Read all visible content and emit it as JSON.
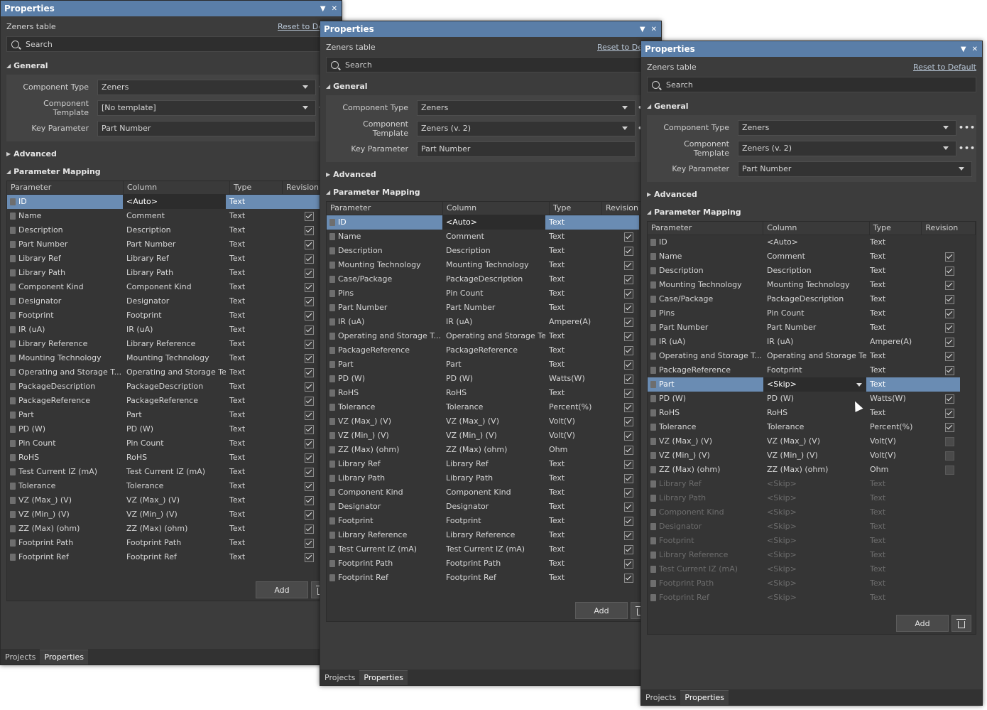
{
  "panel_title": "Properties",
  "panel_subtitle": "Zeners table",
  "reset_label": "Reset to Default",
  "reset_label_clipped": "Reset to De",
  "reset_label_clipped2": "Reset to Def",
  "search_placeholder": "Search",
  "sections": {
    "general": "General",
    "advanced": "Advanced",
    "mapping": "Parameter Mapping"
  },
  "field_labels": {
    "component_type": "Component Type",
    "component_template": "Component Template",
    "key_parameter": "Key Parameter"
  },
  "columns": {
    "parameter": "Parameter",
    "column": "Column",
    "type": "Type",
    "revision": "Revision"
  },
  "buttons": {
    "add": "Add"
  },
  "tabs": {
    "projects": "Projects",
    "properties": "Properties"
  },
  "icons": {
    "search": "search-icon",
    "pin": "pin-icon",
    "close": "close-icon",
    "doc": "document-icon",
    "trash": "trash-icon"
  },
  "colors": {
    "titlebar": "#5a7ea8",
    "selection": "#6a8cb3",
    "panel_bg": "#3c3c3c"
  },
  "panels": [
    {
      "component_type": "Zeners",
      "component_template": "[No template]",
      "key_parameter": "Part Number",
      "rows": [
        {
          "p": "ID",
          "c": "<Auto>",
          "t": "Text",
          "r": "none",
          "sel": true
        },
        {
          "p": "Name",
          "c": "Comment",
          "t": "Text",
          "r": "on"
        },
        {
          "p": "Description",
          "c": "Description",
          "t": "Text",
          "r": "on"
        },
        {
          "p": "Part Number",
          "c": "Part Number",
          "t": "Text",
          "r": "on"
        },
        {
          "p": "Library Ref",
          "c": "Library Ref",
          "t": "Text",
          "r": "on"
        },
        {
          "p": "Library Path",
          "c": "Library Path",
          "t": "Text",
          "r": "on"
        },
        {
          "p": "Component Kind",
          "c": "Component Kind",
          "t": "Text",
          "r": "on"
        },
        {
          "p": "Designator",
          "c": "Designator",
          "t": "Text",
          "r": "on"
        },
        {
          "p": "Footprint",
          "c": "Footprint",
          "t": "Text",
          "r": "on"
        },
        {
          "p": "IR (uA)",
          "c": "IR (uA)",
          "t": "Text",
          "r": "on"
        },
        {
          "p": "Library Reference",
          "c": "Library Reference",
          "t": "Text",
          "r": "on"
        },
        {
          "p": "Mounting Technology",
          "c": "Mounting Technology",
          "t": "Text",
          "r": "on"
        },
        {
          "p": "Operating and Storage T...",
          "c": "Operating and Storage Temp",
          "t": "Text",
          "r": "on"
        },
        {
          "p": "PackageDescription",
          "c": "PackageDescription",
          "t": "Text",
          "r": "on"
        },
        {
          "p": "PackageReference",
          "c": "PackageReference",
          "t": "Text",
          "r": "on"
        },
        {
          "p": "Part",
          "c": "Part",
          "t": "Text",
          "r": "on"
        },
        {
          "p": "PD (W)",
          "c": "PD (W)",
          "t": "Text",
          "r": "on"
        },
        {
          "p": "Pin Count",
          "c": "Pin Count",
          "t": "Text",
          "r": "on"
        },
        {
          "p": "RoHS",
          "c": "RoHS",
          "t": "Text",
          "r": "on"
        },
        {
          "p": "Test Current IZ (mA)",
          "c": "Test Current IZ (mA)",
          "t": "Text",
          "r": "on"
        },
        {
          "p": "Tolerance",
          "c": "Tolerance",
          "t": "Text",
          "r": "on"
        },
        {
          "p": "VZ (Max_) (V)",
          "c": "VZ (Max_) (V)",
          "t": "Text",
          "r": "on"
        },
        {
          "p": "VZ (Min_) (V)",
          "c": "VZ (Min_) (V)",
          "t": "Text",
          "r": "on"
        },
        {
          "p": "ZZ (Max) (ohm)",
          "c": "ZZ (Max) (ohm)",
          "t": "Text",
          "r": "on"
        },
        {
          "p": "Footprint Path",
          "c": "Footprint Path",
          "t": "Text",
          "r": "on"
        },
        {
          "p": "Footprint Ref",
          "c": "Footprint Ref",
          "t": "Text",
          "r": "on"
        }
      ]
    },
    {
      "component_type": "Zeners",
      "component_template": "Zeners (v. 2)",
      "key_parameter": "Part Number",
      "rows": [
        {
          "p": "ID",
          "c": "<Auto>",
          "t": "Text",
          "r": "none",
          "sel": true
        },
        {
          "p": "Name",
          "c": "Comment",
          "t": "Text",
          "r": "on"
        },
        {
          "p": "Description",
          "c": "Description",
          "t": "Text",
          "r": "on"
        },
        {
          "p": "Mounting Technology",
          "c": "Mounting Technology",
          "t": "Text",
          "r": "on"
        },
        {
          "p": "Case/Package",
          "c": "PackageDescription",
          "t": "Text",
          "r": "on"
        },
        {
          "p": "Pins",
          "c": "Pin Count",
          "t": "Text",
          "r": "on"
        },
        {
          "p": "Part Number",
          "c": "Part Number",
          "t": "Text",
          "r": "on"
        },
        {
          "p": "IR (uA)",
          "c": "IR (uA)",
          "t": "Ampere(A)",
          "r": "on"
        },
        {
          "p": "Operating and Storage T...",
          "c": "Operating and Storage Temp",
          "t": "Text",
          "r": "on"
        },
        {
          "p": "PackageReference",
          "c": "PackageReference",
          "t": "Text",
          "r": "on"
        },
        {
          "p": "Part",
          "c": "Part",
          "t": "Text",
          "r": "on"
        },
        {
          "p": "PD (W)",
          "c": "PD (W)",
          "t": "Watts(W)",
          "r": "on"
        },
        {
          "p": "RoHS",
          "c": "RoHS",
          "t": "Text",
          "r": "on"
        },
        {
          "p": "Tolerance",
          "c": "Tolerance",
          "t": "Percent(%)",
          "r": "on"
        },
        {
          "p": "VZ (Max_) (V)",
          "c": "VZ (Max_) (V)",
          "t": "Volt(V)",
          "r": "on"
        },
        {
          "p": "VZ (Min_) (V)",
          "c": "VZ (Min_) (V)",
          "t": "Volt(V)",
          "r": "on"
        },
        {
          "p": "ZZ (Max) (ohm)",
          "c": "ZZ (Max) (ohm)",
          "t": "Ohm",
          "r": "on"
        },
        {
          "p": "Library Ref",
          "c": "Library Ref",
          "t": "Text",
          "r": "on"
        },
        {
          "p": "Library Path",
          "c": "Library Path",
          "t": "Text",
          "r": "on"
        },
        {
          "p": "Component Kind",
          "c": "Component Kind",
          "t": "Text",
          "r": "on"
        },
        {
          "p": "Designator",
          "c": "Designator",
          "t": "Text",
          "r": "on"
        },
        {
          "p": "Footprint",
          "c": "Footprint",
          "t": "Text",
          "r": "on"
        },
        {
          "p": "Library Reference",
          "c": "Library Reference",
          "t": "Text",
          "r": "on"
        },
        {
          "p": "Test Current IZ (mA)",
          "c": "Test Current IZ (mA)",
          "t": "Text",
          "r": "on"
        },
        {
          "p": "Footprint Path",
          "c": "Footprint Path",
          "t": "Text",
          "r": "on"
        },
        {
          "p": "Footprint Ref",
          "c": "Footprint Ref",
          "t": "Text",
          "r": "on"
        }
      ]
    },
    {
      "component_type": "Zeners",
      "component_template": "Zeners (v. 2)",
      "key_parameter": "Part Number",
      "rows": [
        {
          "p": "ID",
          "c": "<Auto>",
          "t": "Text",
          "r": "none"
        },
        {
          "p": "Name",
          "c": "Comment",
          "t": "Text",
          "r": "on"
        },
        {
          "p": "Description",
          "c": "Description",
          "t": "Text",
          "r": "on"
        },
        {
          "p": "Mounting Technology",
          "c": "Mounting Technology",
          "t": "Text",
          "r": "on"
        },
        {
          "p": "Case/Package",
          "c": "PackageDescription",
          "t": "Text",
          "r": "on"
        },
        {
          "p": "Pins",
          "c": "Pin Count",
          "t": "Text",
          "r": "on"
        },
        {
          "p": "Part Number",
          "c": "Part Number",
          "t": "Text",
          "r": "on"
        },
        {
          "p": "IR (uA)",
          "c": "IR (uA)",
          "t": "Ampere(A)",
          "r": "on"
        },
        {
          "p": "Operating and Storage T...",
          "c": "Operating and Storage Temp",
          "t": "Text",
          "r": "on"
        },
        {
          "p": "PackageReference",
          "c": "Footprint",
          "t": "Text",
          "r": "on"
        },
        {
          "p": "Part",
          "c": "<Skip>",
          "t": "Text",
          "r": "none",
          "sel": true,
          "dropdown": true
        },
        {
          "p": "PD (W)",
          "c": "PD (W)",
          "t": "Watts(W)",
          "r": "on"
        },
        {
          "p": "RoHS",
          "c": "RoHS",
          "t": "Text",
          "r": "on"
        },
        {
          "p": "Tolerance",
          "c": "Tolerance",
          "t": "Percent(%)",
          "r": "on"
        },
        {
          "p": "VZ (Max_) (V)",
          "c": "VZ (Max_) (V)",
          "t": "Volt(V)",
          "r": "unset"
        },
        {
          "p": "VZ (Min_) (V)",
          "c": "VZ (Min_) (V)",
          "t": "Volt(V)",
          "r": "unset"
        },
        {
          "p": "ZZ (Max) (ohm)",
          "c": "ZZ (Max) (ohm)",
          "t": "Ohm",
          "r": "unset"
        },
        {
          "p": "Library Ref",
          "c": "<Skip>",
          "t": "Text",
          "r": "none",
          "dim": true
        },
        {
          "p": "Library Path",
          "c": "<Skip>",
          "t": "Text",
          "r": "none",
          "dim": true
        },
        {
          "p": "Component Kind",
          "c": "<Skip>",
          "t": "Text",
          "r": "none",
          "dim": true
        },
        {
          "p": "Designator",
          "c": "<Skip>",
          "t": "Text",
          "r": "none",
          "dim": true
        },
        {
          "p": "Footprint",
          "c": "<Skip>",
          "t": "Text",
          "r": "none",
          "dim": true
        },
        {
          "p": "Library Reference",
          "c": "<Skip>",
          "t": "Text",
          "r": "none",
          "dim": true
        },
        {
          "p": "Test Current IZ (mA)",
          "c": "<Skip>",
          "t": "Text",
          "r": "none",
          "dim": true
        },
        {
          "p": "Footprint Path",
          "c": "<Skip>",
          "t": "Text",
          "r": "none",
          "dim": true
        },
        {
          "p": "Footprint Ref",
          "c": "<Skip>",
          "t": "Text",
          "r": "none",
          "dim": true
        }
      ]
    }
  ]
}
